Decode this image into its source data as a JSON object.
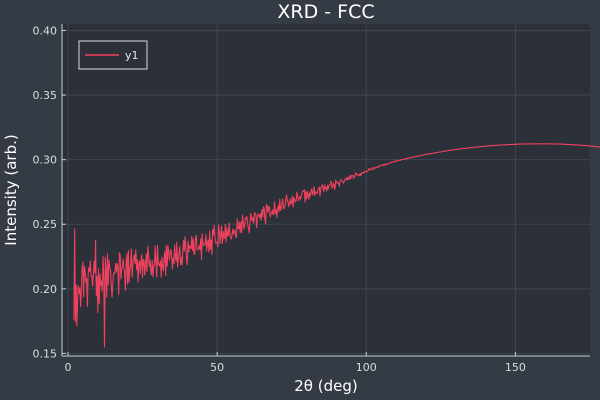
{
  "chart_data": {
    "type": "line",
    "title": "XRD - FCC",
    "xlabel": "2θ (deg)",
    "ylabel": "Intensity (arb.)",
    "xlim": [
      -2,
      175
    ],
    "ylim": [
      0.148,
      0.405
    ],
    "xticks": [
      0,
      50,
      100,
      150
    ],
    "yticks": [
      0.15,
      0.2,
      0.25,
      0.3,
      0.35,
      0.4
    ],
    "ytick_labels": [
      "0.15",
      "0.20",
      "0.25",
      "0.30",
      "0.35",
      "0.40"
    ],
    "grid": true,
    "legend_position": "top-left",
    "series": [
      {
        "name": "y1",
        "color": "#f0415e",
        "x_start": 2,
        "x_step": 0.25,
        "values": [
          0.1761,
          0.2464,
          0.1744,
          0.2029,
          0.1714,
          0.1943,
          0.2024,
          0.1963,
          0.2006,
          0.186,
          0.1999,
          0.2162,
          0.2207,
          0.1937,
          0.2174,
          0.2139,
          0.2048,
          0.2081,
          0.1864,
          0.2109,
          0.2164,
          0.2134,
          0.2216,
          0.2097,
          0.2101,
          0.2021,
          0.2094,
          0.2211,
          0.2123,
          0.2374,
          0.1948,
          0.2096,
          0.1816,
          0.2155,
          0.1887,
          0.2115,
          0.2028,
          0.2059,
          0.1982,
          0.2248,
          0.2074,
          0.155,
          0.2245,
          0.2155,
          0.1935,
          0.227,
          0.2032,
          0.2223,
          0.2165,
          0.2144,
          0.2039,
          0.1934,
          0.2031,
          0.2117,
          0.2124,
          0.2118,
          0.2197,
          0.213,
          0.2196,
          0.2169,
          0.1957,
          0.2279,
          0.2259,
          0.2077,
          0.2147,
          0.2178,
          0.2231,
          0.2147,
          0.2141,
          0.1987,
          0.2196,
          0.2272,
          0.2039,
          0.2296,
          0.2051,
          0.2153,
          0.219,
          0.2308,
          0.2089,
          0.2176,
          0.2237,
          0.2264,
          0.2196,
          0.2304,
          0.2149,
          0.2225,
          0.2054,
          0.2199,
          0.2217,
          0.2118,
          0.2224,
          0.2264,
          0.2087,
          0.2227,
          0.2222,
          0.2106,
          0.2183,
          0.2271,
          0.2135,
          0.2329,
          0.2275,
          0.2174,
          0.2224,
          0.2142,
          0.2109,
          0.2221,
          0.2092,
          0.2181,
          0.2183,
          0.2331,
          0.2202,
          0.2091,
          0.2335,
          0.2207,
          0.2184,
          0.2176,
          0.2216,
          0.2091,
          0.2241,
          0.2166,
          0.2139,
          0.2257,
          0.2288,
          0.2103,
          0.2333,
          0.2175,
          0.2334,
          0.2305,
          0.2222,
          0.2271,
          0.2305,
          0.2267,
          0.2156,
          0.2238,
          0.2195,
          0.2341,
          0.2244,
          0.2213,
          0.2362,
          0.2169,
          0.2227,
          0.2277,
          0.2327,
          0.2186,
          0.2242,
          0.2186,
          0.2289,
          0.2376,
          0.2291,
          0.2403,
          0.2334,
          0.2234,
          0.2186,
          0.2369,
          0.2285,
          0.2333,
          0.2317,
          0.2311,
          0.2407,
          0.2298,
          0.2386,
          0.2266,
          0.2271,
          0.2391,
          0.2416,
          0.2307,
          0.2303,
          0.2309,
          0.2335,
          0.2303,
          0.2388,
          0.2226,
          0.2426,
          0.2353,
          0.2332,
          0.2342,
          0.2344,
          0.2422,
          0.2294,
          0.2351,
          0.2379,
          0.2285,
          0.2447,
          0.2305,
          0.2379,
          0.2266,
          0.246,
          0.2417,
          0.2491,
          0.2413,
          0.2354,
          0.2358,
          0.236,
          0.2327,
          0.2493,
          0.2439,
          0.2351,
          0.2423,
          0.2486,
          0.2351,
          0.2443,
          0.2389,
          0.2394,
          0.2498,
          0.2363,
          0.2471,
          0.2412,
          0.2408,
          0.2508,
          0.2425,
          0.2402,
          0.2386,
          0.2416,
          0.2462,
          0.2422,
          0.2448,
          0.2457,
          0.2394,
          0.241,
          0.2543,
          0.2467,
          0.2464,
          0.2518,
          0.2437,
          0.2517,
          0.2432,
          0.2571,
          0.2516,
          0.2463,
          0.2497,
          0.255,
          0.2542,
          0.256,
          0.2499,
          0.2465,
          0.2432,
          0.2513,
          0.2582,
          0.2537,
          0.2525,
          0.2555,
          0.2507,
          0.2589,
          0.2583,
          0.2572,
          0.2472,
          0.2557,
          0.2576,
          0.2575,
          0.255,
          0.2582,
          0.2531,
          0.2612,
          0.2556,
          0.2634,
          0.2621,
          0.255,
          0.2501,
          0.2652,
          0.2641,
          0.2591,
          0.2638,
          0.2634,
          0.2555,
          0.2579,
          0.2583,
          0.2611,
          0.2574,
          0.2581,
          0.2674,
          0.2586,
          0.2611,
          0.2554,
          0.2616,
          0.2643,
          0.2598,
          0.2695,
          0.2608,
          0.2623,
          0.2654,
          0.2694,
          0.2619,
          0.2625,
          0.2637,
          0.2682,
          0.2726,
          0.2683,
          0.2673,
          0.2636,
          0.2664,
          0.2695,
          0.2657,
          0.2664,
          0.2719,
          0.2632,
          0.2706,
          0.2691,
          0.2673,
          0.2684,
          0.2748,
          0.2721,
          0.2681,
          0.2706,
          0.2713,
          0.2694,
          0.2725,
          0.2744,
          0.2758,
          0.2753,
          0.2767,
          0.2671,
          0.2753,
          0.2696,
          0.2752,
          0.2727,
          0.2693,
          0.2743,
          0.2718,
          0.276,
          0.2773,
          0.2727,
          0.2748,
          0.279,
          0.2723,
          0.2751,
          0.2743,
          0.2736,
          0.2767,
          0.2774,
          0.2788,
          0.2719,
          0.2781,
          0.2792,
          0.2805,
          0.2786,
          0.2751,
          0.2803,
          0.2777,
          0.2784,
          0.2758,
          0.2801,
          0.2772,
          0.2799,
          0.2806,
          0.2811,
          0.2834,
          0.2779,
          0.2786,
          0.2815,
          0.2804,
          0.2769,
          0.2843,
          0.2821,
          0.2821,
          0.2825,
          0.2815,
          0.2794,
          0.2837,
          0.2843,
          0.284,
          0.2836,
          0.2819,
          0.2829,
          0.2834,
          0.2854,
          0.2854,
          0.2841,
          0.2864,
          0.2847,
          0.2851,
          0.2876,
          0.285,
          0.2879,
          0.2875,
          0.2878,
          0.2855,
          0.2863,
          0.2885,
          0.2898,
          0.2883,
          0.288,
          0.2885,
          0.2874,
          0.2885,
          0.2892,
          0.2876,
          0.29,
          0.2899,
          0.2901,
          0.2895,
          0.2911,
          0.2909,
          0.2908,
          0.2906,
          0.2908,
          0.2926,
          0.2932,
          0.2918,
          0.2926,
          0.2926,
          0.2923,
          0.294,
          0.2934,
          0.2927,
          0.2939,
          0.2941,
          0.2938,
          0.2947,
          0.2945,
          0.2941,
          0.2953,
          0.2954,
          0.2957,
          0.2954,
          0.2958,
          0.2963,
          0.2955,
          0.2966,
          0.2962,
          0.2966,
          0.2964,
          0.2968,
          0.2969,
          0.2971,
          0.2975,
          0.2981,
          0.2979,
          0.2981,
          0.298,
          0.2985,
          0.2986,
          0.2989,
          0.2984,
          0.2991,
          0.2992,
          0.2993,
          0.2995,
          0.2997,
          0.2994,
          0.3,
          0.3001,
          0.3001,
          0.3003,
          0.3005,
          0.3006,
          0.3008,
          0.3006,
          0.301,
          0.3012,
          0.3012,
          0.3013,
          0.3015,
          0.3016,
          0.3017,
          0.3019,
          0.302,
          0.3021,
          0.3023,
          0.3024,
          0.3024,
          0.3026,
          0.3027,
          0.3028,
          0.303,
          0.3031,
          0.3032,
          0.3033,
          0.3034,
          0.3035,
          0.3037,
          0.3038,
          0.3039,
          0.304,
          0.3041,
          0.3042,
          0.3043,
          0.3044,
          0.3045,
          0.3046,
          0.3047,
          0.3048,
          0.3049,
          0.305,
          0.3051,
          0.3052,
          0.3053,
          0.3054,
          0.3055,
          0.3056,
          0.3057,
          0.3058,
          0.3059,
          0.306,
          0.3061,
          0.3062,
          0.3063,
          0.3064,
          0.3065,
          0.3066,
          0.3067,
          0.3068,
          0.3069,
          0.307,
          0.3071,
          0.3072,
          0.3072,
          0.3073,
          0.3074,
          0.3075,
          0.3076,
          0.3077,
          0.3077,
          0.3078,
          0.3079,
          0.308,
          0.3081,
          0.3081,
          0.3082,
          0.3083,
          0.3084,
          0.3084,
          0.3085,
          0.3086,
          0.3087,
          0.3087,
          0.3088,
          0.3089,
          0.3089,
          0.309,
          0.3091,
          0.3091,
          0.3092,
          0.3093,
          0.3093,
          0.3094,
          0.3095,
          0.3095,
          0.3096,
          0.3096,
          0.3097,
          0.3098,
          0.3098,
          0.3099,
          0.3099,
          0.31,
          0.31,
          0.3101,
          0.3102,
          0.3102,
          0.3103,
          0.3103,
          0.3104,
          0.3104,
          0.3105,
          0.3105,
          0.3106,
          0.3106,
          0.3107,
          0.3107,
          0.3108,
          0.3108,
          0.3108,
          0.3109,
          0.3109,
          0.311,
          0.311,
          0.3111,
          0.3111,
          0.3111,
          0.3112,
          0.3112,
          0.3113,
          0.3113,
          0.3113,
          0.3114,
          0.3114,
          0.3114,
          0.3115,
          0.3115,
          0.3115,
          0.3116,
          0.3116,
          0.3116,
          0.3117,
          0.3117,
          0.3117,
          0.3117,
          0.3118,
          0.3118,
          0.3118,
          0.3119,
          0.3119,
          0.3119,
          0.3119,
          0.3119,
          0.312,
          0.312,
          0.312,
          0.312,
          0.312,
          0.3121,
          0.3121,
          0.3121,
          0.3121,
          0.3121,
          0.3121,
          0.3122,
          0.3122,
          0.3122,
          0.3122,
          0.3122,
          0.3122,
          0.3122,
          0.3122,
          0.3122,
          0.3123,
          0.3123,
          0.3123,
          0.3123,
          0.3123,
          0.3123,
          0.3123,
          0.3123,
          0.3123,
          0.3123,
          0.3123,
          0.3123,
          0.3123,
          0.3123,
          0.3123,
          0.3123,
          0.3123,
          0.3123,
          0.3123,
          0.3123,
          0.3123,
          0.3123,
          0.3123,
          0.3122,
          0.3122,
          0.3122,
          0.3122,
          0.3122,
          0.3122,
          0.3122,
          0.3122,
          0.3121,
          0.3121,
          0.3121,
          0.3121,
          0.3121,
          0.3121,
          0.312,
          0.312,
          0.312,
          0.312,
          0.3119,
          0.3119,
          0.3119,
          0.3119,
          0.3118,
          0.3118,
          0.3118,
          0.3118,
          0.3117,
          0.3117,
          0.3117,
          0.3116,
          0.3116,
          0.3116,
          0.3115,
          0.3115,
          0.3115,
          0.3114,
          0.3114,
          0.3113,
          0.3113,
          0.3113,
          0.3112,
          0.3112,
          0.3111,
          0.3111,
          0.311,
          0.311,
          0.311,
          0.3109,
          0.3109,
          0.3108,
          0.3108,
          0.3107,
          0.3107,
          0.3106,
          0.3106,
          0.3105,
          0.3104,
          0.3104,
          0.3103,
          0.3103,
          0.3102,
          0.3102,
          0.3101,
          0.31,
          0.31,
          0.3099,
          0.3099,
          0.3098,
          0.3097,
          0.3097,
          0.3096,
          0.3095,
          0.3095,
          0.3094,
          0.3093,
          0.3092,
          0.3092,
          0.3091,
          0.309,
          0.309,
          0.3089,
          0.3088,
          0.3087,
          0.3086,
          0.3086,
          0.3085,
          0.3084,
          0.3083,
          0.3083,
          0.3082,
          0.3081,
          0.308,
          0.3079,
          0.3078,
          0.3078,
          0.3077,
          0.3076,
          0.3075,
          0.3074,
          0.3073,
          0.3072,
          0.3071,
          0.307,
          0.307,
          0.3069,
          0.3068,
          0.3067,
          0.3066,
          0.3065,
          0.3064,
          0.3063,
          0.3062,
          0.3061,
          0.306,
          0.3059,
          0.3058,
          0.3057,
          0.3056,
          0.3055,
          0.3054,
          0.3053,
          0.3052,
          0.3051,
          0.305,
          0.3049,
          0.3047,
          0.3046,
          0.3045,
          0.3044,
          0.3043,
          0.3042,
          0.3041,
          0.304,
          0.3039,
          0.3037,
          0.3036,
          0.3035,
          0.3034,
          0.3033,
          0.3031,
          0.303,
          0.3029,
          0.3028,
          0.3027,
          0.3025,
          0.3024,
          0.3023,
          0.3022,
          0.302,
          0.3019,
          0.3018,
          0.3017,
          0.3015,
          0.3014,
          0.3013,
          0.3011,
          0.301,
          0.3009,
          0.3007,
          0.3006,
          0.3005,
          0.3003,
          0.3002,
          0.3001,
          0.2999,
          0.2998,
          0.2997,
          0.2995,
          0.2994,
          0.2992,
          0.2991,
          0.299
        ]
      }
    ]
  }
}
